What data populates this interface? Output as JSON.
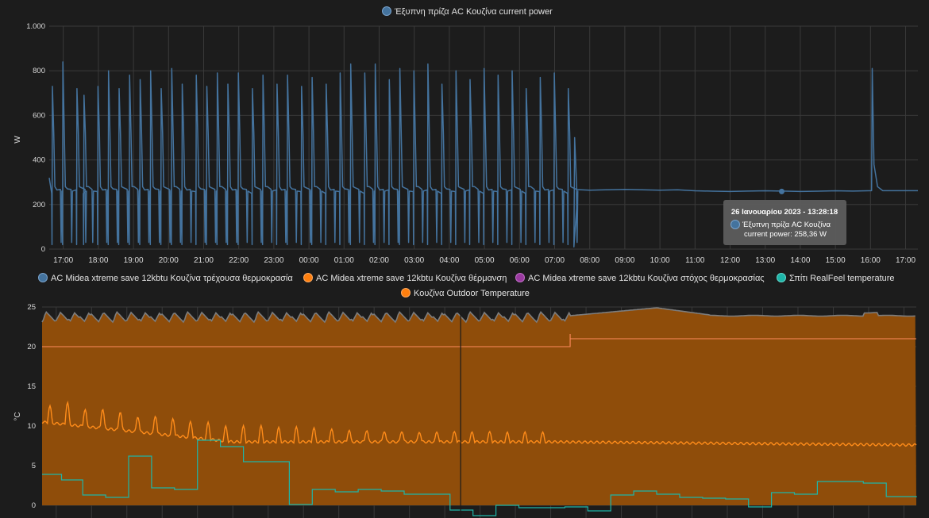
{
  "chart_data": [
    {
      "type": "line",
      "legend": [
        {
          "label": "Έξυπνη πρίζα AC Κουζίνα current power",
          "color": "#44739e"
        }
      ],
      "ylabel": "W",
      "ylim": [
        0,
        1000
      ],
      "yticks": [
        "0",
        "200",
        "400",
        "600",
        "800",
        "1.000"
      ],
      "xticks": [
        "17:00",
        "18:00",
        "19:00",
        "20:00",
        "21:00",
        "22:00",
        "23:00",
        "00:00",
        "01:00",
        "02:00",
        "03:00",
        "04:00",
        "05:00",
        "06:00",
        "07:00",
        "08:00",
        "09:00",
        "10:00",
        "11:00",
        "12:00",
        "13:00",
        "14:00",
        "15:00",
        "16:00",
        "17:00"
      ],
      "xlim_hours": [
        16.6,
        41.35
      ],
      "series": [
        {
          "name": "Έξυπνη πρίζα AC Κουζίνα current power",
          "color": "#44739e",
          "baseline_w": 250,
          "cycle_spikes_h": [
            16.7,
            17.0,
            17.4,
            17.6,
            18.0,
            18.3,
            18.6,
            18.9,
            19.2,
            19.5,
            19.8,
            20.1,
            20.4,
            20.8,
            21.1,
            21.4,
            21.7,
            22.0,
            22.4,
            22.7,
            23.1,
            23.4,
            23.8,
            24.1,
            24.5,
            24.9,
            25.2,
            25.6,
            25.9,
            26.3,
            26.6,
            27.0,
            27.4,
            27.8,
            28.2,
            28.6,
            29.0,
            29.4,
            29.8,
            30.2,
            30.6,
            31.0,
            31.4
          ],
          "spike_peaks_w": [
            730,
            840,
            720,
            690,
            730,
            800,
            720,
            780,
            760,
            800,
            720,
            810,
            740,
            780,
            730,
            790,
            740,
            790,
            720,
            780,
            740,
            780,
            730,
            770,
            740,
            790,
            830,
            790,
            830,
            760,
            810,
            800,
            830,
            740,
            800,
            760,
            810,
            780,
            800,
            720,
            770,
            790,
            720
          ],
          "last_cycle_end_h": 31.55,
          "steady_level_w": 262,
          "late_spike_h": 40.05,
          "late_spike_peak_w": 810
        }
      ],
      "tooltip": {
        "title": "26 Ιανουαρίου 2023 - 13:28:18",
        "line1": "Έξυπνη πρίζα AC Κουζίνα",
        "line2": "current power: 258,36 W",
        "x_h": 37.47,
        "y_w": 258.36
      }
    },
    {
      "type": "area",
      "legend": [
        {
          "label": "AC Midea xtreme save 12kbtu Κουζίνα τρέχουσα θερμοκρασία",
          "color": "#44739e"
        },
        {
          "label": "AC Midea xtreme save 12kbtu Κουζίνα θέρμανση",
          "color": "#ff7f0e"
        },
        {
          "label": "AC Midea xtreme save 12kbtu Κουζίνα στόχος θερμοκρασίας",
          "color": "#9a3aa0"
        },
        {
          "label": "Σπίτι RealFeel temperature",
          "color": "#1eb5a8"
        },
        {
          "label": "Κουζίνα Outdoor Temperature",
          "color": "#ff7f0e"
        }
      ],
      "ylabel": "°C",
      "ylim": [
        -1.6,
        25
      ],
      "yticks": [
        "0",
        "5",
        "10",
        "15",
        "20",
        "25"
      ],
      "xlim_hours": [
        16.6,
        41.35
      ],
      "heating_fill_color": "#8f4d0a",
      "series": [
        {
          "name": "AC Midea xtreme save 12kbtu Κουζίνα τρέχουσα θερμοκρασία",
          "color": "#7d7d7d",
          "mean_before_c": 23.6,
          "amp_before_c": 1.1,
          "oscillation_period_h": 0.4,
          "switch_h": 31.55,
          "level_after_c": 24.0,
          "peak_c": 24.9,
          "peak_h": 34.0
        },
        {
          "name": "AC Midea xtreme save 12kbtu Κουζίνα στόχος θερμοκρασίας",
          "color": "#ff8a5c",
          "before_c": 20.0,
          "after_c": 21.0,
          "switch_h": 31.55
        },
        {
          "name": "Κουζίνα Outdoor Temperature",
          "color": "#ff8c1a",
          "start_c": 10.5,
          "mid_c": 8.0,
          "end_c": 7.6,
          "bump_heights_c": [
            2.1,
            2.8,
            2.2,
            2.5,
            2.4,
            2.0,
            2.3,
            2.2,
            2.0,
            2.1,
            1.8,
            1.9,
            1.9,
            1.7,
            1.8,
            1.7,
            1.6,
            1.5,
            1.5,
            1.4,
            1.4,
            1.3,
            1.3,
            1.3,
            1.2,
            1.2,
            1.1,
            1.1,
            1.1
          ]
        },
        {
          "name": "Σπίτι RealFeel temperature",
          "color": "#1eb5a8",
          "steps": [
            {
              "h": 16.6,
              "c": 3.9
            },
            {
              "h": 17.15,
              "c": 3.2
            },
            {
              "h": 17.75,
              "c": 1.3
            },
            {
              "h": 18.4,
              "c": 1.0
            },
            {
              "h": 19.05,
              "c": 6.2
            },
            {
              "h": 19.7,
              "c": 2.2
            },
            {
              "h": 20.35,
              "c": 2.0
            },
            {
              "h": 21.0,
              "c": 8.2
            },
            {
              "h": 21.65,
              "c": 7.4
            },
            {
              "h": 22.3,
              "c": 5.5
            },
            {
              "h": 23.6,
              "c": 0.1
            },
            {
              "h": 24.25,
              "c": 2.0
            },
            {
              "h": 24.9,
              "c": 1.7
            },
            {
              "h": 25.55,
              "c": 2.0
            },
            {
              "h": 26.2,
              "c": 1.8
            },
            {
              "h": 26.85,
              "c": 1.4
            },
            {
              "h": 28.15,
              "c": -0.6
            },
            {
              "h": 28.8,
              "c": -1.3
            },
            {
              "h": 29.45,
              "c": 0.0
            },
            {
              "h": 30.1,
              "c": -0.3
            },
            {
              "h": 30.75,
              "c": -0.3
            },
            {
              "h": 31.4,
              "c": -0.2
            },
            {
              "h": 32.05,
              "c": -0.7
            },
            {
              "h": 32.7,
              "c": 1.3
            },
            {
              "h": 33.35,
              "c": 1.8
            },
            {
              "h": 34.0,
              "c": 1.4
            },
            {
              "h": 34.65,
              "c": 1.0
            },
            {
              "h": 35.3,
              "c": 0.9
            },
            {
              "h": 35.95,
              "c": 0.8
            },
            {
              "h": 36.6,
              "c": -0.2
            },
            {
              "h": 37.25,
              "c": 1.6
            },
            {
              "h": 37.9,
              "c": 1.4
            },
            {
              "h": 38.55,
              "c": 3.0
            },
            {
              "h": 39.85,
              "c": 2.8
            },
            {
              "h": 40.5,
              "c": 1.1
            },
            {
              "h": 41.35,
              "c": 1.0
            }
          ]
        }
      ],
      "crosshair_h": 28.45
    }
  ]
}
